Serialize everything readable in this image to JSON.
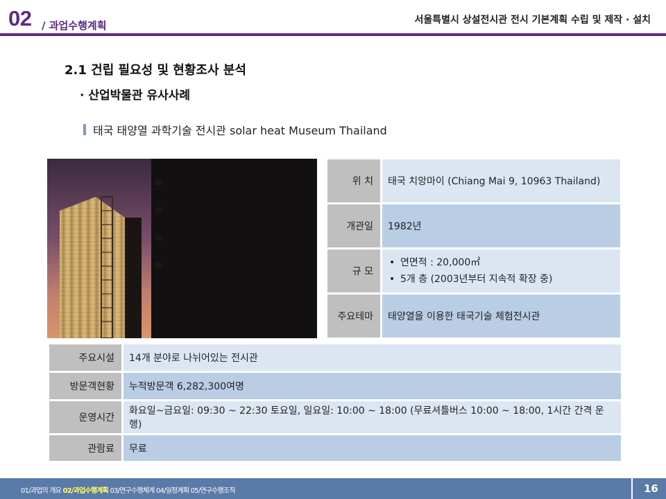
{
  "header": {
    "section_number": "02",
    "section_title": "/ 과업수행계획",
    "document_title": "서울특별시 상설전시관 전시 기본계획 수립 및 제작 · 설치",
    "accent_color": "#5b2a86"
  },
  "content": {
    "heading1": "2.1 건립 필요성 및 현황조사 분석",
    "heading2": "· 산업박물관 유사사례",
    "case_title": "태국 태양열 과학기술 전시관 solar heat Museum Thailand"
  },
  "info_table": {
    "location": {
      "label": "위  치",
      "value": "태국 치앙마이 (Chiang Mai 9, 10963 Thailand)"
    },
    "opened": {
      "label": "개관일",
      "value": "1982년"
    },
    "scale": {
      "label": "규 모",
      "items": [
        "연면적 : 20,000㎡",
        "5개 층 (2003년부터 지속적 확장 중)"
      ]
    },
    "theme": {
      "label": "주요테마",
      "value": "태양열을 이용한 태국기술 체험전시관"
    }
  },
  "bottom_table": {
    "facilities": {
      "label": "주요시설",
      "value": "14개 분야로 나뉘어있는 전시관"
    },
    "visitors": {
      "label": "방문객현황",
      "value": "누적방문객 6,282,300여명"
    },
    "hours": {
      "label": "운영시간",
      "value": "화요일~금요일: 09:30 ~ 22:30 토요일, 일요일: 10:00 ~ 18:00 (무료셔틀버스 10:00 ~ 18:00, 1시간 간격 운행)"
    },
    "admission": {
      "label": "관람료",
      "value": "무료"
    }
  },
  "footer": {
    "nav": [
      "01/과업의 개요",
      "02/과업수행계획",
      "03/연구수행체계",
      "04/일정계획",
      "05/연구수행조직"
    ],
    "current": "02/과업수행계획",
    "page_number": "16"
  }
}
